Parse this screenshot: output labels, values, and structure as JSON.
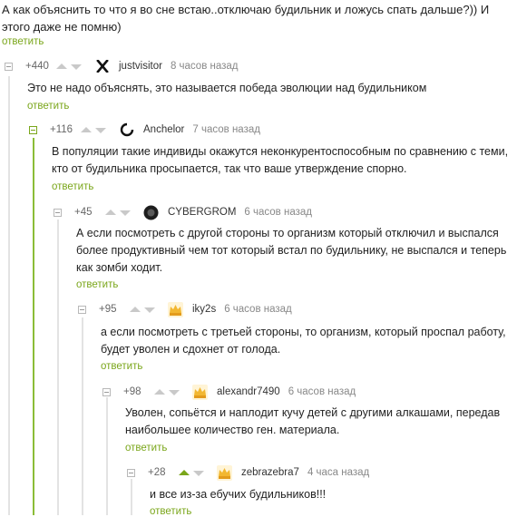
{
  "parent": {
    "text": "А как объяснить то что я во сне встаю..отключаю будильник и ложусь спать дальше?)) И этого даже не помню)",
    "reply_label": "ответить"
  },
  "comments": [
    {
      "rating": "+440",
      "username": "justvisitor",
      "time": "8 часов назад",
      "avatar_icon": "x-logo-avatar-icon",
      "text": "Это не надо объяснять, это называется победа эволюции над будильником",
      "reply_label": "ответить"
    },
    {
      "rating": "+116",
      "username": "Anchelor",
      "time": "7 часов назад",
      "avatar_icon": "ring-avatar-icon",
      "text": "В популяции такие индивиды окажутся неконкурентоспособным по сравнению с теми, кто от будильника просыпается, так что ваше утверждение спорно.",
      "reply_label": "ответить"
    },
    {
      "rating": "+45",
      "username": "CYBERGROM",
      "time": "6 часов назад",
      "avatar_icon": "dark-avatar-icon",
      "text": "А если посмотреть с другой стороны то организм который отключил и выспался более продуктивный чем тот который встал по будильнику, не выспался и теперь как зомби ходит.",
      "reply_label": "ответить"
    },
    {
      "rating": "+95",
      "username": "iky2s",
      "time": "6 часов назад",
      "avatar_icon": "crown-avatar-icon",
      "text": "а если посмотреть с третьей стороны, то организм, который проспал работу, будет уволен и сдохнет от голода.",
      "reply_label": "ответить"
    },
    {
      "rating": "+98",
      "username": "alexandr7490",
      "time": "6 часов назад",
      "avatar_icon": "crown-avatar-icon",
      "text": "Уволен, сопьётся и наплодит кучу детей с другими алкашами, передав наибольшее количество ген. материала.",
      "reply_label": "ответить"
    },
    {
      "rating": "+28",
      "username": "zebrazebra7",
      "time": "4 часа назад",
      "avatar_icon": "crown-avatar-icon",
      "text": "и все из-за ебучих будильников!!!",
      "reply_label": "ответить"
    }
  ],
  "colors": {
    "accent": "#7aa61a",
    "thread_line": "#8bbd37",
    "arrow": "#c9c9c9"
  }
}
